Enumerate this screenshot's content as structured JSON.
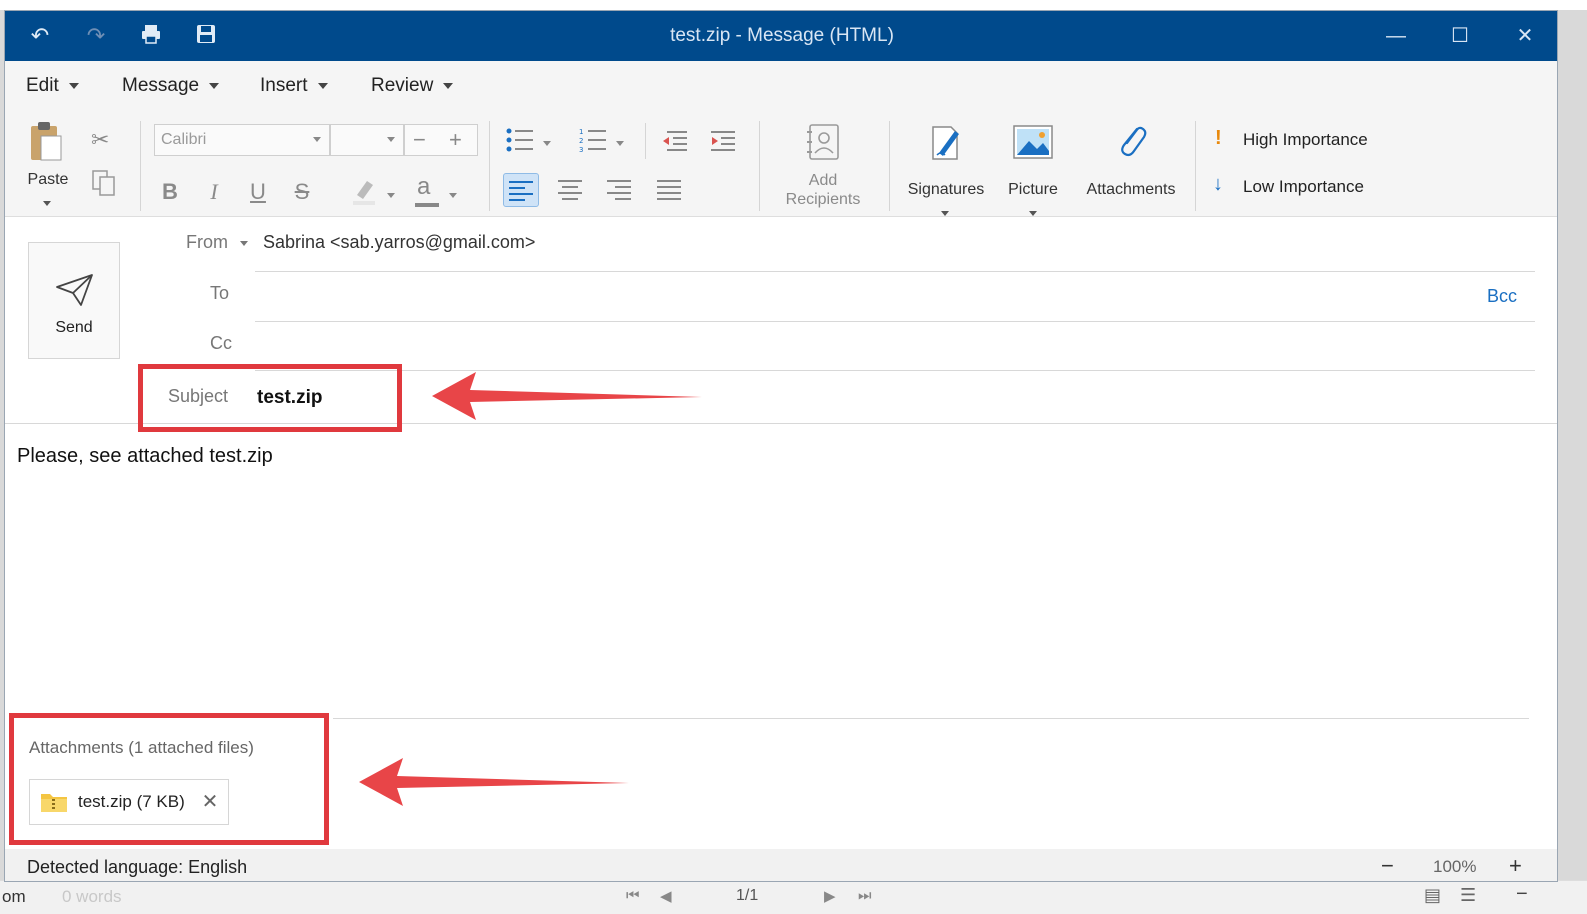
{
  "window": {
    "title": "test.zip - Message (HTML)"
  },
  "menu": {
    "items": [
      "Edit",
      "Message",
      "Insert",
      "Review"
    ]
  },
  "ribbon": {
    "paste_label": "Paste",
    "font_placeholder": "Calibri",
    "add_recipients_label": "Add\nRecipients",
    "signatures_label": "Signatures",
    "picture_label": "Picture",
    "attachments_label": "Attachments",
    "high_importance_label": "High Importance",
    "low_importance_label": "Low Importance"
  },
  "header": {
    "send_label": "Send",
    "from_label": "From",
    "from_value": "Sabrina <sab.yarros@gmail.com>",
    "to_label": "To",
    "bcc_label": "Bcc",
    "cc_label": "Cc",
    "subject_label": "Subject",
    "subject_value": "test.zip"
  },
  "body": {
    "text": "Please, see attached test.zip"
  },
  "attachments": {
    "title": "Attachments (1 attached files)",
    "files": [
      {
        "name": "test.zip (7 KB)"
      }
    ]
  },
  "status": {
    "language": "Detected language: English",
    "zoom": "100%",
    "page": "1/1"
  },
  "background": {
    "left_fragment": "om",
    "words": "0 words"
  },
  "colors": {
    "titlebar": "#004a8c",
    "accent": "#1a6fc2",
    "annotation": "#e0393e",
    "importance_high": "#e8890c"
  }
}
